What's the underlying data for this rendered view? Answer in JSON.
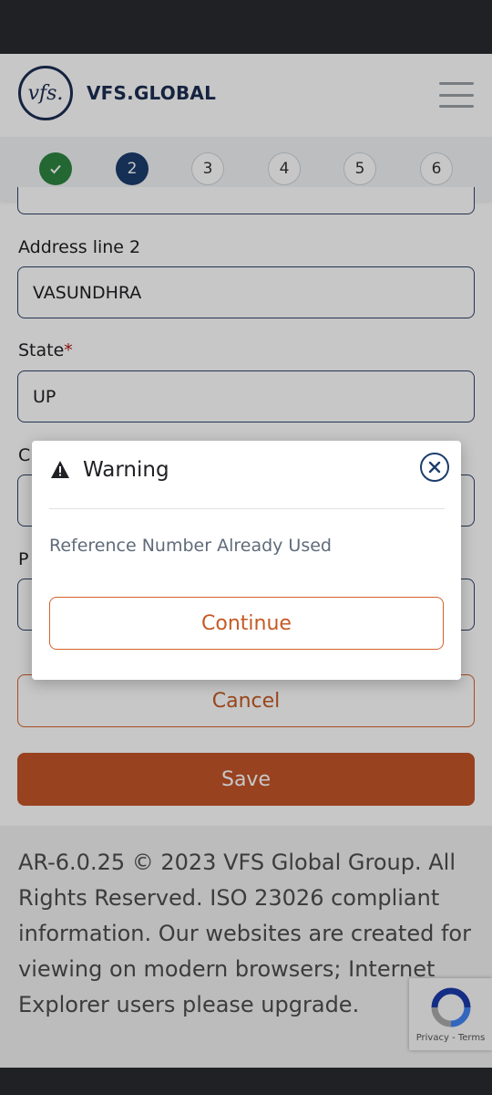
{
  "header": {
    "logo_mark": "vfs.",
    "logo_text": "VFS.GLOBAL",
    "menu_icon": "hamburger-menu-icon"
  },
  "stepper": {
    "steps": [
      "2",
      "3",
      "4",
      "5",
      "6"
    ],
    "completed_icon": "checkmark-icon"
  },
  "form": {
    "address2_label": "Address line 2",
    "address2_value": "VASUNDHRA",
    "state_label": "State",
    "required_mark": "*",
    "state_value": "UP",
    "city_label_partial": "C",
    "postal_label_partial": "P",
    "cancel_label": "Cancel",
    "save_label": "Save"
  },
  "footer": {
    "text": "AR-6.0.25 © 2023 VFS Global Group. All Rights Reserved. ISO 23026 compliant information. Our websites are created for viewing on modern browsers; Internet Explorer users please upgrade."
  },
  "dialog": {
    "title": "Warning",
    "message": "Reference Number Already Used",
    "continue_label": "Continue",
    "icons": [
      "warning-icon",
      "close-icon"
    ]
  },
  "recaptcha": {
    "links": "Privacy - Terms"
  },
  "colors": {
    "brand_navy": "#1c2d52",
    "accent_orange": "#c4552a",
    "success_green": "#2e8540",
    "active_step": "#1c3d6e"
  }
}
